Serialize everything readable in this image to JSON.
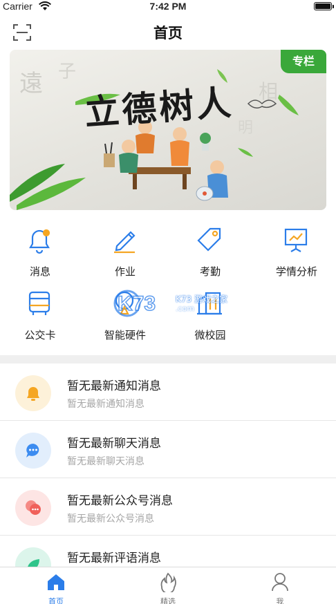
{
  "status_bar": {
    "carrier": "Carrier",
    "time": "7:42 PM"
  },
  "nav": {
    "title": "首页",
    "scan_icon": "scan-icon"
  },
  "banner": {
    "badge": "专栏",
    "title": "立德树人"
  },
  "functions": [
    {
      "label": "消息",
      "icon": "bell-icon"
    },
    {
      "label": "作业",
      "icon": "pencil-icon"
    },
    {
      "label": "考勤",
      "icon": "tag-icon"
    },
    {
      "label": "学情分析",
      "icon": "presentation-chart-icon"
    },
    {
      "label": "公交卡",
      "icon": "bus-icon"
    },
    {
      "label": "智能硬件",
      "icon": "lamp-icon"
    },
    {
      "label": "微校园",
      "icon": "building-icon"
    }
  ],
  "watermark": {
    "text": "K73 游戏之家",
    "sub": ".com"
  },
  "messages": [
    {
      "title": "暂无最新通知消息",
      "subtitle": "暂无最新通知消息",
      "icon": "bell-icon",
      "color": "#f5a623"
    },
    {
      "title": "暂无最新聊天消息",
      "subtitle": "暂无最新聊天消息",
      "icon": "chat-bubble-icon",
      "color": "#3c8cf0"
    },
    {
      "title": "暂无最新公众号消息",
      "subtitle": "暂无最新公众号消息",
      "icon": "chat-bubbles-icon",
      "color": "#f0605a"
    },
    {
      "title": "暂无最新评语消息",
      "subtitle": "",
      "icon": "leaf-icon",
      "color": "#2fc48a"
    }
  ],
  "tabs": [
    {
      "label": "首页",
      "icon": "home-icon",
      "active": true
    },
    {
      "label": "精选",
      "icon": "flame-icon",
      "active": false
    },
    {
      "label": "我",
      "icon": "person-icon",
      "active": false
    }
  ],
  "colors": {
    "accent": "#2b7de9",
    "badge": "#3aa83a",
    "icon_orange": "#f5a623"
  }
}
